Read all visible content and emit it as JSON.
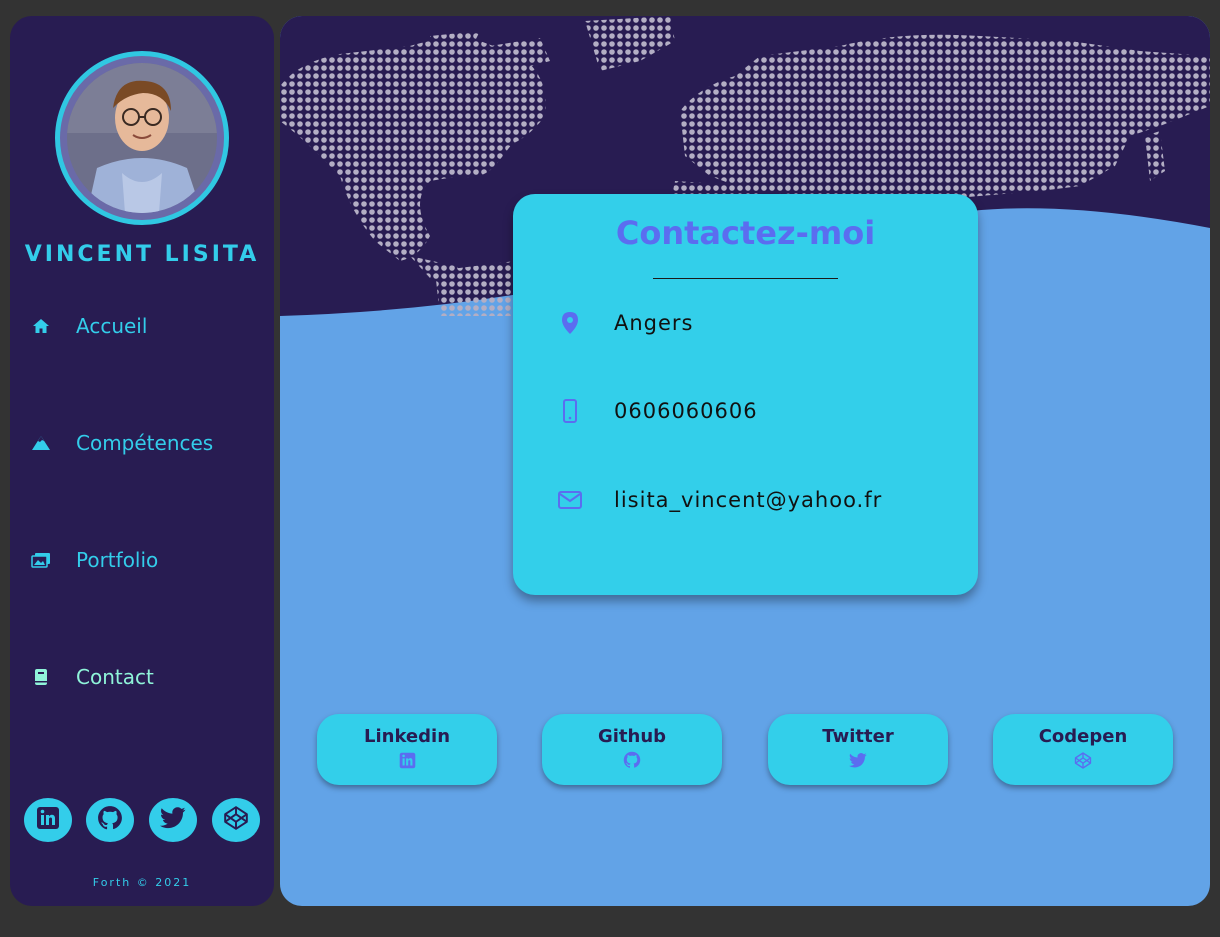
{
  "profile": {
    "name": "VINCENT LISITA"
  },
  "nav": {
    "items": [
      {
        "label": "Accueil",
        "icon": "home-icon"
      },
      {
        "label": "Compétences",
        "icon": "mountain-icon"
      },
      {
        "label": "Portfolio",
        "icon": "images-icon"
      },
      {
        "label": "Contact",
        "icon": "book-icon"
      }
    ],
    "active": "Contact"
  },
  "social_icons": [
    "linkedin-icon",
    "github-icon",
    "twitter-icon",
    "codepen-icon"
  ],
  "footer": {
    "text": "Forth © 2021"
  },
  "contact": {
    "title": "Contactez-moi",
    "location": "Angers",
    "phone": "0606060606",
    "email": "lisita_vincent@yahoo.fr"
  },
  "links": [
    {
      "label": "Linkedin",
      "icon": "linkedin-icon"
    },
    {
      "label": "Github",
      "icon": "github-icon"
    },
    {
      "label": "Twitter",
      "icon": "twitter-icon"
    },
    {
      "label": "Codepen",
      "icon": "codepen-icon"
    }
  ],
  "colors": {
    "background": "#333333",
    "sidebar": "#281c52",
    "accent": "#33cdea",
    "active": "#8ff4d9",
    "main": "#62a3e7",
    "title": "#5b6df0",
    "map_dots": "#b3aec4"
  }
}
